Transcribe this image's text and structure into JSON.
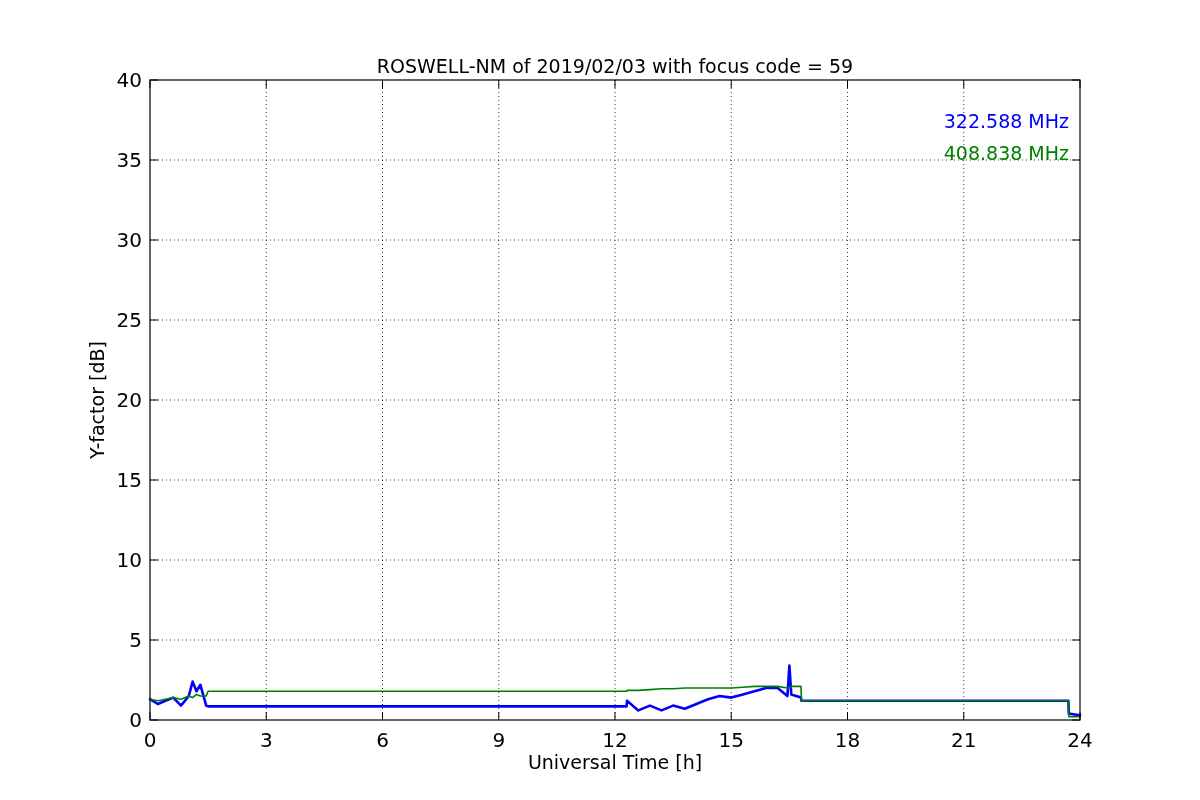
{
  "chart_data": {
    "type": "line",
    "title": "ROSWELL-NM of 2019/02/03 with focus code = 59",
    "xlabel": "Universal Time [h]",
    "ylabel": "Y-factor [dB]",
    "x": [
      0,
      0.2,
      0.4,
      0.6,
      0.8,
      1.0,
      1.1,
      1.2,
      1.3,
      1.45,
      1.5,
      12.3,
      12.31,
      12.6,
      12.9,
      13.2,
      13.5,
      13.8,
      14.1,
      14.4,
      14.7,
      15.0,
      15.3,
      15.6,
      15.9,
      16.2,
      16.45,
      16.5,
      16.55,
      16.8,
      16.81,
      23.7,
      23.71,
      24.0
    ],
    "series": [
      {
        "name": "322.588 MHz",
        "color": "#0000ff",
        "values": [
          1.3,
          1.0,
          1.2,
          1.4,
          0.9,
          1.5,
          2.4,
          1.8,
          2.2,
          0.9,
          0.85,
          0.85,
          1.2,
          0.6,
          0.9,
          0.6,
          0.9,
          0.7,
          1.0,
          1.3,
          1.5,
          1.4,
          1.6,
          1.8,
          2.0,
          2.0,
          1.5,
          3.4,
          1.6,
          1.4,
          1.2,
          1.2,
          0.4,
          0.3
        ]
      },
      {
        "name": "408.838 MHz",
        "color": "#008000",
        "values": [
          1.3,
          1.2,
          1.3,
          1.4,
          1.3,
          1.5,
          1.4,
          1.6,
          1.5,
          1.5,
          1.8,
          1.8,
          1.85,
          1.85,
          1.9,
          1.95,
          1.95,
          2.0,
          2.0,
          2.0,
          2.0,
          2.0,
          2.05,
          2.1,
          2.1,
          2.1,
          2.0,
          2.0,
          2.1,
          2.1,
          1.2,
          1.2,
          0.2,
          0.2
        ]
      }
    ],
    "xlim": [
      0,
      24
    ],
    "ylim": [
      0,
      40
    ],
    "xticks": [
      0,
      3,
      6,
      9,
      12,
      15,
      18,
      21,
      24
    ],
    "yticks": [
      0,
      5,
      10,
      15,
      20,
      25,
      30,
      35,
      40
    ],
    "grid": true
  }
}
